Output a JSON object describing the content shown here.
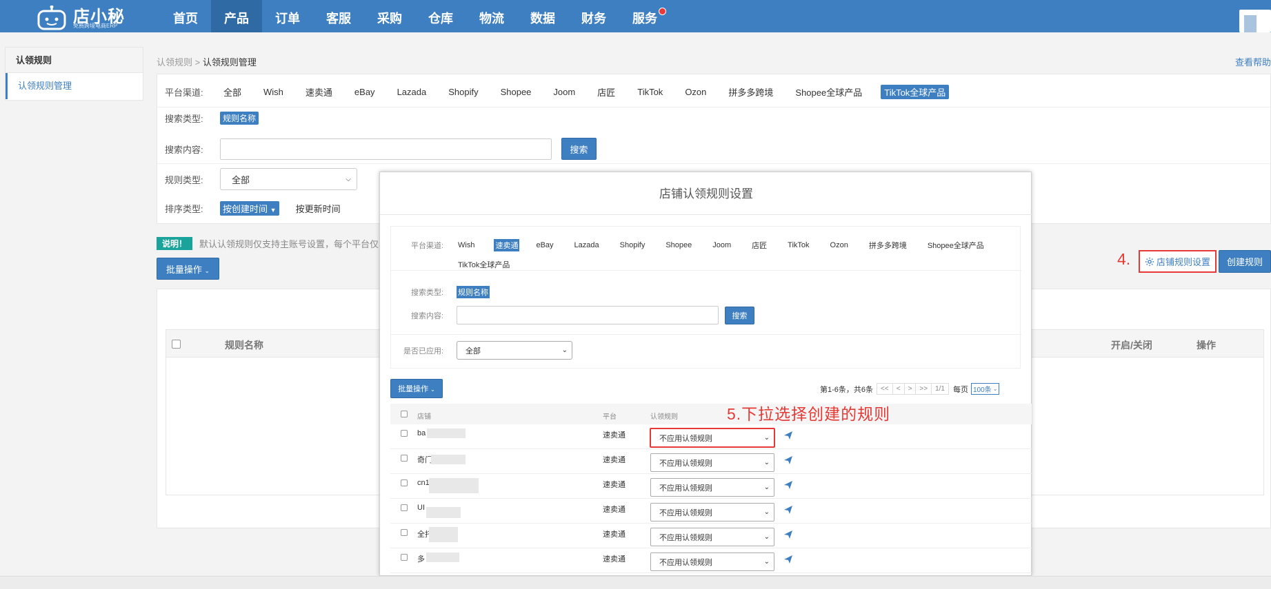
{
  "app": {
    "logo_title": "店小秘",
    "logo_sub": "免费跨境电商ERP",
    "nav": [
      "首页",
      "产品",
      "订单",
      "客服",
      "采购",
      "仓库",
      "物流",
      "数据",
      "财务",
      "服务"
    ],
    "nav_active_index": 1,
    "accent_color": "#3d7fc1"
  },
  "sidebar": {
    "header": "认领规则",
    "items": [
      {
        "label": "认领规则管理"
      }
    ]
  },
  "breadcrumb": {
    "parent": "认领规则",
    "sep": ">",
    "current": "认领规则管理"
  },
  "help_link": "查看帮助",
  "filters": {
    "platform_label": "平台渠道:",
    "platforms": [
      "全部",
      "Wish",
      "速卖通",
      "eBay",
      "Lazada",
      "Shopify",
      "Shopee",
      "Joom",
      "店匠",
      "TikTok",
      "Ozon",
      "拼多多跨境",
      "Shopee全球产品",
      "TikTok全球产品"
    ],
    "platform_active": "TikTok全球产品",
    "search_type_label": "搜索类型:",
    "search_type_value": "规则名称",
    "search_content_label": "搜索内容:",
    "search_content_value": "",
    "search_button": "搜索",
    "rule_type_label": "规则类型:",
    "rule_type_value": "全部",
    "sort_label": "排序类型:",
    "sort_active": "按创建时间",
    "sort_other": "按更新时间"
  },
  "notice": {
    "badge": "说明！",
    "text": "默认认领规则仅支持主账号设置，每个平台仅"
  },
  "batch_button": "批量操作",
  "annotation_step4": "4.",
  "shop_rule_button": "店铺规则设置",
  "create_rule_button": "创建规则",
  "list_table": {
    "columns": [
      "规则名称",
      "开启/关闭",
      "操作"
    ]
  },
  "modal": {
    "title": "店铺认领规则设置",
    "platform_label": "平台渠道:",
    "platforms": [
      "Wish",
      "速卖通",
      "eBay",
      "Lazada",
      "Shopify",
      "Shopee",
      "Joom",
      "店匠",
      "TikTok",
      "Ozon",
      "拼多多跨境",
      "Shopee全球产品",
      "TikTok全球产品"
    ],
    "platform_active": "速卖通",
    "search_type_label": "搜索类型:",
    "search_type_value": "规则名称",
    "search_content_label": "搜索内容:",
    "search_button": "搜索",
    "applied_label": "是否已应用:",
    "applied_value": "全部",
    "batch_button": "批量操作",
    "pager": {
      "summary": "第1-6条，共6条",
      "first": "<<",
      "prev": "<",
      "next": ">",
      "last": ">>",
      "pages": "1/1",
      "per_page_label": "每页",
      "per_page_value": "100条"
    },
    "columns": {
      "shop": "店铺",
      "platform": "平台",
      "rule": "认领规则"
    },
    "annotation_step5": "5.下拉选择创建的规则",
    "rows": [
      {
        "shop": "ba",
        "platform": "速卖通",
        "rule": "不应用认领规则"
      },
      {
        "shop": "奇门",
        "platform": "速卖通",
        "rule": "不应用认领规则"
      },
      {
        "shop": "cn1",
        "platform": "速卖通",
        "rule": "不应用认领规则"
      },
      {
        "shop": "UI",
        "platform": "速卖通",
        "rule": "不应用认领规则"
      },
      {
        "shop": "全托",
        "platform": "速卖通",
        "rule": "不应用认领规则"
      },
      {
        "shop": "多",
        "platform": "速卖通",
        "rule": "不应用认领规则"
      }
    ]
  }
}
